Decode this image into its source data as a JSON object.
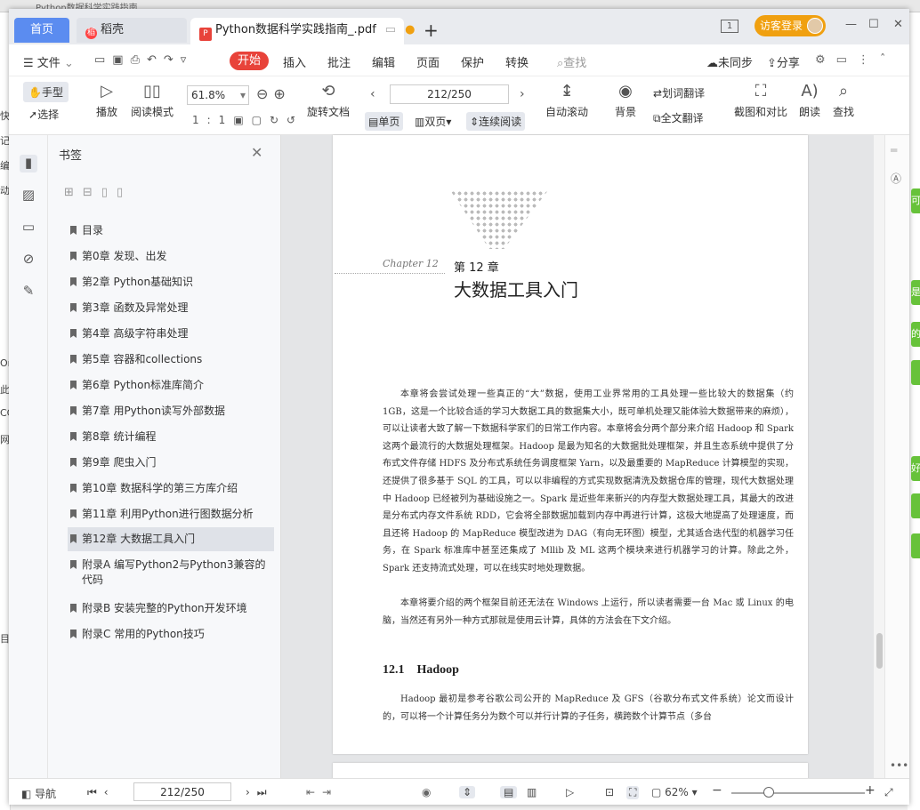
{
  "background": {
    "window_title_fragment": "Python数据科学实践指南",
    "left_glyphs": [
      "快",
      "记",
      "编",
      "动",
      "",
      "",
      "",
      "",
      "",
      "",
      "On",
      "此",
      "CC",
      "网",
      "",
      "",
      "",
      "",
      "",
      "",
      "",
      "目"
    ],
    "right_chips": [
      "可",
      "是",
      "的",
      "",
      "好",
      "",
      ""
    ]
  },
  "tabs": {
    "home": "首页",
    "docer": "稻壳",
    "pdf": "Python数据科学实践指南_.pdf",
    "add": "+"
  },
  "titlebar": {
    "page_indicator": "1",
    "login": "访客登录",
    "minimize": "—",
    "restore": "☐",
    "close": "✕"
  },
  "menu": {
    "file": "文件",
    "start": "开始",
    "items": [
      "插入",
      "批注",
      "编辑",
      "页面",
      "保护",
      "转换"
    ],
    "search": "查找",
    "sync": "未同步",
    "share": "分享"
  },
  "toolbar": {
    "hand": "手型",
    "select": "选择",
    "play": "播放",
    "read_mode": "阅读模式",
    "zoom": "61.8%",
    "rotate": "旋转文档",
    "page": "212/250",
    "single": "单页",
    "double": "双页",
    "continuous": "连续阅读",
    "auto_scroll": "自动滚动",
    "background": "背景",
    "word_translate": "划词翻译",
    "full_translate": "全文翻译",
    "screenshot_compare": "截图和对比",
    "read_aloud": "朗读",
    "find": "查找",
    "ratio": "1:1"
  },
  "bookmarks": {
    "title": "书签",
    "items": [
      "目录",
      "第0章 发现、出发",
      "第2章 Python基础知识",
      "第3章 函数及异常处理",
      "第4章 高级字符串处理",
      "第5章 容器和collections",
      "第6章 Python标准库简介",
      "第7章 用Python读写外部数据",
      "第8章 统计编程",
      "第9章 爬虫入门",
      "第10章 数据科学的第三方库介绍",
      "第11章 利用Python进行图数据分析",
      "第12章 大数据工具入门",
      "附录A 编写Python2与Python3兼容的代码",
      "附录B 安装完整的Python开发环境",
      "附录C 常用的Python技巧"
    ],
    "active_index": 12
  },
  "document": {
    "chapter_script": "Chapter 12",
    "chapter_number": "第 12 章",
    "chapter_title": "大数据工具入门",
    "paragraph1": "本章将会尝试处理一些真正的“大”数据，使用工业界常用的工具处理一些比较大的数据集（约 1GB，这是一个比较合适的学习大数据工具的数据集大小，既可单机处理又能体验大数据带来的麻烦），可以让读者大致了解一下数据科学家们的日常工作内容。本章将会分两个部分来介绍 Hadoop 和 Spark 这两个最流行的大数据处理框架。Hadoop 是最为知名的大数据批处理框架，并且生态系统中提供了分布式文件存储 HDFS 及分布式系统任务调度框架 Yarn，以及最重要的 MapReduce 计算模型的实现，还提供了很多基于 SQL 的工具，可以以非编程的方式实现数据清洗及数据仓库的管理，现代大数据处理中 Hadoop 已经被列为基础设施之一。Spark 是近些年来新兴的内存型大数据处理工具，其最大的改进是分布式内存文件系统 RDD，它会将全部数据加载到内存中再进行计算，这极大地提高了处理速度，而且还将 Hadoop 的 MapReduce 模型改进为 DAG（有向无环图）模型，尤其适合迭代型的机器学习任务，在 Spark 标准库中甚至还集成了 Mllib 及 ML 这两个模块来进行机器学习的计算。除此之外，Spark 还支持流式处理，可以在线实时地处理数据。",
    "paragraph2": "本章将要介绍的两个框架目前还无法在 Windows 上运行，所以读者需要一台 Mac 或 Linux 的电脑，当然还有另外一种方式那就是使用云计算，具体的方法会在下文介绍。",
    "section_number": "12.1",
    "section_title": "Hadoop",
    "paragraph3": "Hadoop 最初是参考谷歌公司公开的 MapReduce 及 GFS（谷歌分布式文件系统）论文而设计的，可以将一个计算任务分为数个可以并行计算的子任务，横跨数个计算节点（多台"
  },
  "status": {
    "nav": "导航",
    "page": "212/250",
    "zoom": "62%",
    "zoom_level": 0.28
  }
}
